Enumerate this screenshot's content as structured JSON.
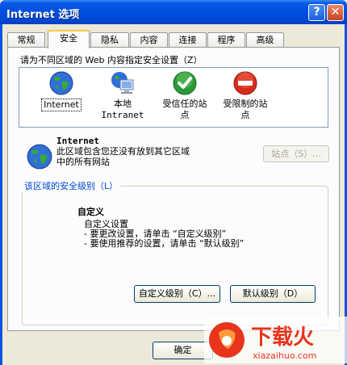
{
  "window": {
    "title": "Internet 选项"
  },
  "titlebar": {
    "help_label": "?",
    "close_label": "✕"
  },
  "tabs": [
    {
      "label": "常规"
    },
    {
      "label": "安全"
    },
    {
      "label": "隐私"
    },
    {
      "label": "内容"
    },
    {
      "label": "连接"
    },
    {
      "label": "程序"
    },
    {
      "label": "高级"
    }
  ],
  "zones": {
    "label": "请为不同区域的 Web 内容指定安全设置（Z）",
    "items": [
      {
        "label": "Internet",
        "icon": "globe-icon"
      },
      {
        "label": "本地 Intranet",
        "line1": "本地",
        "line2": "Intranet",
        "icon": "computer-globe-icon"
      },
      {
        "label": "受信任的站点",
        "line1": "受信任的站",
        "line2": "点",
        "icon": "check-icon"
      },
      {
        "label": "受限制的站点",
        "line1": "受限制的站",
        "line2": "点",
        "icon": "forbidden-icon"
      }
    ]
  },
  "zone_info": {
    "title": "Internet",
    "desc_line1": "此区域包含您还没有放到其它区域",
    "desc_line2": "中的所有网站",
    "sites_button": "站点（S）..."
  },
  "security_level": {
    "legend": "该区域的安全级别（L）",
    "title": "自定义",
    "line1": "自定义设置",
    "line2": "- 要更改设置，请单击 “自定义级别”",
    "line3": "- 要使用推荐的设置，请单击 “默认级别”",
    "custom_button": "自定义级别（C）...",
    "default_button": "默认级别（D）"
  },
  "footer": {
    "ok_button": "确定"
  },
  "watermark": {
    "text": "下载火",
    "subtext": "xiazaihuo.com"
  },
  "colors": {
    "title_blue": "#0054e3",
    "legend_blue": "#0046d5",
    "tab_highlight": "#ffc83c",
    "watermark_red": "#e8341c"
  }
}
